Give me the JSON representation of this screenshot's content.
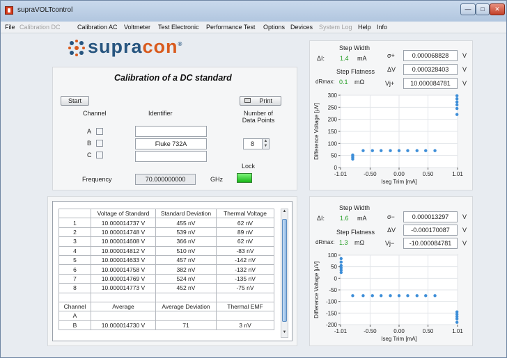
{
  "window": {
    "title": "supraVOLTcontrol",
    "min_glyph": "—",
    "max_glyph": "□",
    "close_glyph": "✕"
  },
  "menu": [
    {
      "label": "File",
      "enabled": true
    },
    {
      "label": "Calibration DC",
      "enabled": false
    },
    {
      "label": "Calibration AC",
      "enabled": true
    },
    {
      "label": "Voltmeter",
      "enabled": true
    },
    {
      "label": "Test Electronic",
      "enabled": true
    },
    {
      "label": "Performance Test",
      "enabled": true
    },
    {
      "label": "Options",
      "enabled": true
    },
    {
      "label": "Devices",
      "enabled": true
    },
    {
      "label": "System Log",
      "enabled": false
    },
    {
      "label": "Help",
      "enabled": true
    },
    {
      "label": "Info",
      "enabled": true
    }
  ],
  "logo": {
    "text_a": "supra",
    "text_b": "con",
    "mark": "®"
  },
  "calibration": {
    "title": "Calibration of a DC standard",
    "start_label": "Start",
    "print_label": "Print",
    "channel_header": "Channel",
    "identifier_header": "Identifier",
    "datapoints_header_1": "Number of",
    "datapoints_header_2": "Data Points",
    "channels": [
      {
        "name": "A",
        "checked": false,
        "identifier": ""
      },
      {
        "name": "B",
        "checked": false,
        "identifier": "Fluke 732A"
      },
      {
        "name": "C",
        "checked": false,
        "identifier": ""
      }
    ],
    "data_points": "8",
    "frequency_label": "Frequency",
    "frequency_value": "70.000000000",
    "frequency_unit": "GHz",
    "lock_label": "Lock",
    "lock_state": "on"
  },
  "results_table": {
    "headers": [
      "",
      "Voltage of Standard",
      "Standard Deviation",
      "Thermal Voltage"
    ],
    "rows": [
      [
        "1",
        "10.000014737 V",
        "455 nV",
        "62 nV"
      ],
      [
        "2",
        "10.000014748 V",
        "539 nV",
        "89 nV"
      ],
      [
        "3",
        "10.000014608 V",
        "366 nV",
        "62 nV"
      ],
      [
        "4",
        "10.000014812 V",
        "510 nV",
        "-83 nV"
      ],
      [
        "5",
        "10.000014633 V",
        "457 nV",
        "-142 nV"
      ],
      [
        "6",
        "10.000014758 V",
        "382 nV",
        "-132 nV"
      ],
      [
        "7",
        "10.000014769 V",
        "524 nV",
        "-135 nV"
      ],
      [
        "8",
        "10.000014773 V",
        "452 nV",
        "-75 nV"
      ]
    ],
    "summary_headers": [
      "Channel",
      "Average",
      "Average Deviation",
      "Thermal EMF"
    ],
    "summary_rows": [
      [
        "A",
        "",
        "",
        ""
      ],
      [
        "B",
        "10.000014730 V",
        "71",
        "3 nV"
      ]
    ]
  },
  "plot_top": {
    "step_width_label": "Step Width",
    "delta_i_symbol": "ΔI:",
    "step_width_value": "1.4",
    "step_width_unit": "mA",
    "step_flatness_label": "Step Flatness",
    "dr_symbol": "dRmax:",
    "step_flatness_value": "0.1",
    "step_flatness_unit": "mΩ",
    "readouts": [
      {
        "symbol": "σ+",
        "value": "0.000068828",
        "unit": "V"
      },
      {
        "symbol": "ΔV",
        "value": "0.000328403",
        "unit": "V"
      },
      {
        "symbol": "Vj+",
        "value": "10.000084781",
        "unit": "V"
      }
    ]
  },
  "plot_bottom": {
    "step_width_label": "Step Width",
    "delta_i_symbol": "ΔI:",
    "step_width_value": "1.6",
    "step_width_unit": "mA",
    "step_flatness_label": "Step Flatness",
    "dr_symbol": "dRmax:",
    "step_flatness_value": "1.3",
    "step_flatness_unit": "mΩ",
    "readouts": [
      {
        "symbol": "σ−",
        "value": "0.000013297",
        "unit": "V"
      },
      {
        "symbol": "ΔV",
        "value": "-0.000170087",
        "unit": "V"
      },
      {
        "symbol": "Vj−",
        "value": "-10.000084781",
        "unit": "V"
      }
    ]
  },
  "chart_data": [
    {
      "type": "scatter",
      "xlabel": "Iseg Trim [mA]",
      "ylabel": "Difference Voltage [µV]",
      "xlim": [
        -1.01,
        1.01
      ],
      "ylim": [
        0,
        300
      ],
      "xticks": [
        "-1.01",
        "-0.50",
        "0.00",
        "0.50",
        "1.01"
      ],
      "yticks": [
        "0",
        "50",
        "100",
        "150",
        "200",
        "250",
        "300"
      ],
      "color": "#3d8ed8",
      "x": [
        -0.8,
        -0.8,
        -0.8,
        -0.8,
        -0.62,
        -0.46,
        -0.31,
        -0.15,
        0.0,
        0.15,
        0.31,
        0.46,
        0.62,
        1.0,
        1.0,
        1.0,
        1.0,
        1.0,
        1.0
      ],
      "y": [
        35,
        42,
        48,
        52,
        70,
        70,
        70,
        70,
        70,
        70,
        70,
        70,
        70,
        220,
        245,
        260,
        272,
        285,
        298
      ]
    },
    {
      "type": "scatter",
      "xlabel": "Iseg Trim [mA]",
      "ylabel": "Difference Voltage [µV]",
      "xlim": [
        -1.01,
        1.01
      ],
      "ylim": [
        -200,
        100
      ],
      "xticks": [
        "-1.01",
        "-0.50",
        "0.00",
        "0.50",
        "1.01"
      ],
      "yticks": [
        "100",
        "50",
        "0",
        "-50",
        "-100",
        "-150",
        "-200"
      ],
      "color": "#3d8ed8",
      "x": [
        -1.0,
        -1.0,
        -1.0,
        -1.0,
        -1.0,
        -1.0,
        -0.8,
        -0.62,
        -0.46,
        -0.31,
        -0.15,
        0.0,
        0.15,
        0.31,
        0.46,
        0.62,
        1.0,
        1.0,
        1.0,
        1.0,
        1.0
      ],
      "y": [
        85,
        70,
        55,
        45,
        35,
        25,
        -75,
        -75,
        -75,
        -75,
        -75,
        -75,
        -75,
        -75,
        -75,
        -75,
        -145,
        -155,
        -165,
        -175,
        -190
      ]
    }
  ]
}
